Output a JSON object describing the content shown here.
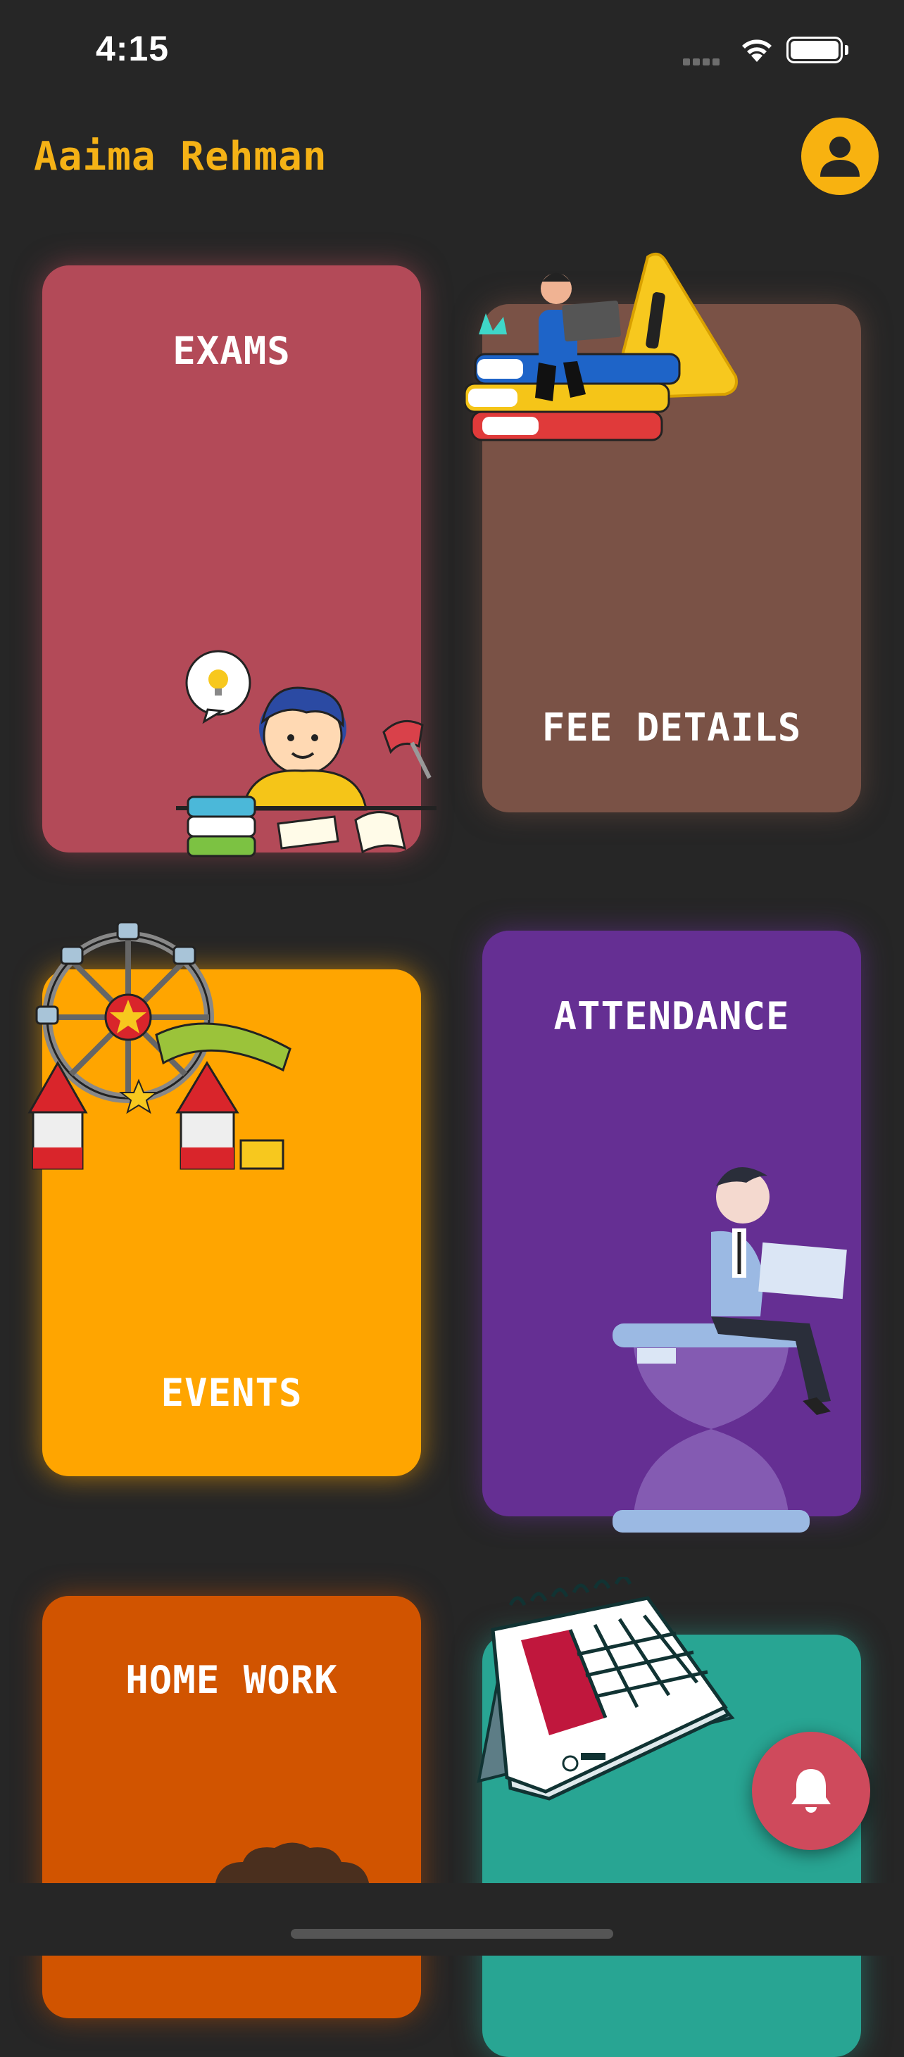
{
  "status_bar": {
    "time": "4:15"
  },
  "header": {
    "user_name": "Aaima Rehman",
    "profile_icon": "person-icon"
  },
  "cards": {
    "exams": {
      "label": "EXAMS",
      "color": "#b34a58"
    },
    "fee_details": {
      "label": "FEE DETAILS",
      "color": "#7a5246"
    },
    "events": {
      "label": "EVENTS",
      "color": "#ffa500"
    },
    "attendance": {
      "label": "ATTENDANCE",
      "color": "#652f93"
    },
    "home_work": {
      "label": "HOME WORK",
      "color": "#d15400"
    },
    "calendar": {
      "label": "",
      "color": "#28a593"
    }
  },
  "fab": {
    "icon": "bell-icon",
    "color": "#cf4a5c"
  },
  "accent": "#f5b216"
}
